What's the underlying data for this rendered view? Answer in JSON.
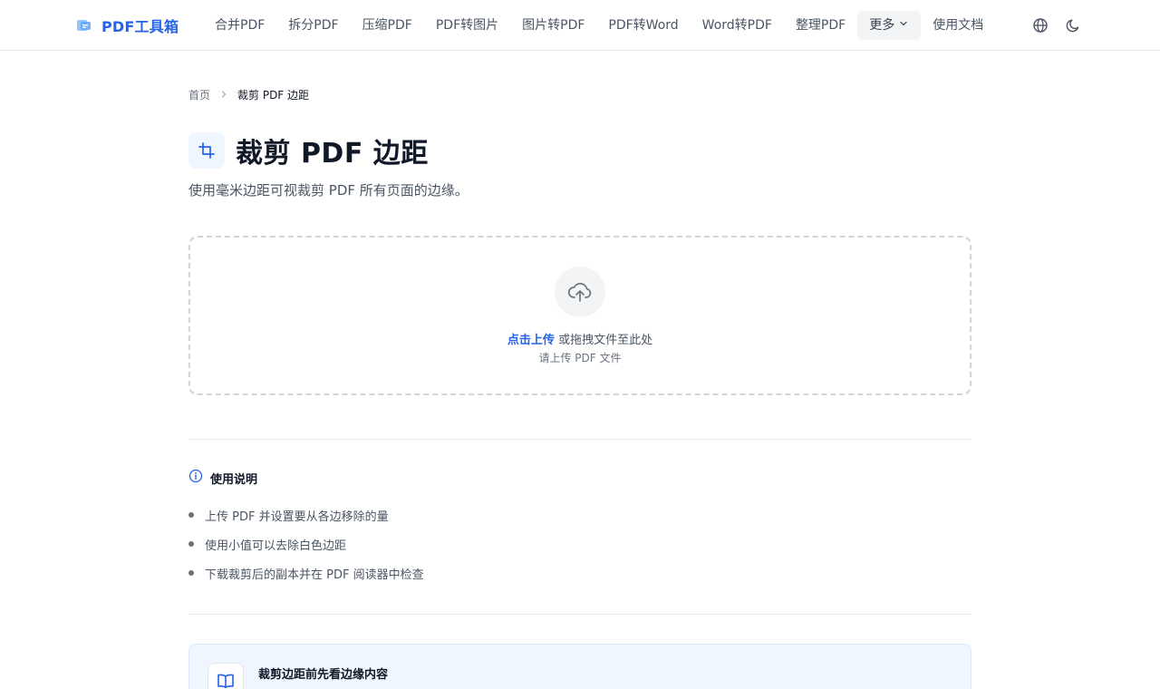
{
  "brand": {
    "name": "PDF工具箱",
    "accent": "#2563eb"
  },
  "nav": {
    "items": [
      {
        "label": "合并PDF"
      },
      {
        "label": "拆分PDF"
      },
      {
        "label": "压缩PDF"
      },
      {
        "label": "PDF转图片"
      },
      {
        "label": "图片转PDF"
      },
      {
        "label": "PDF转Word"
      },
      {
        "label": "Word转PDF"
      },
      {
        "label": "整理PDF"
      }
    ],
    "more_label": "更多",
    "docs_label": "使用文档",
    "icons": {
      "language": "globe-icon",
      "theme": "moon-icon",
      "more": "chevron-down-icon"
    }
  },
  "breadcrumb": {
    "home": "首页",
    "current": "裁剪 PDF 边距"
  },
  "page": {
    "title": "裁剪 PDF 边距",
    "title_icon": "crop-icon",
    "subtitle": "使用毫米边距可视裁剪 PDF 所有页面的边缘。"
  },
  "upload": {
    "icon": "cloud-upload-icon",
    "link_label": "点击上传",
    "text": " 或拖拽文件至此处",
    "hint": "请上传 PDF 文件"
  },
  "instructions": {
    "icon": "info-icon",
    "title": "使用说明",
    "items": [
      "上传 PDF 并设置要从各边移除的量",
      "使用小值可以去除白色边距",
      "下载裁剪后的副本并在 PDF 阅读器中检查"
    ]
  },
  "tip": {
    "icon": "book-open-icon",
    "title": "裁剪边距前先看边缘内容",
    "description": ""
  }
}
